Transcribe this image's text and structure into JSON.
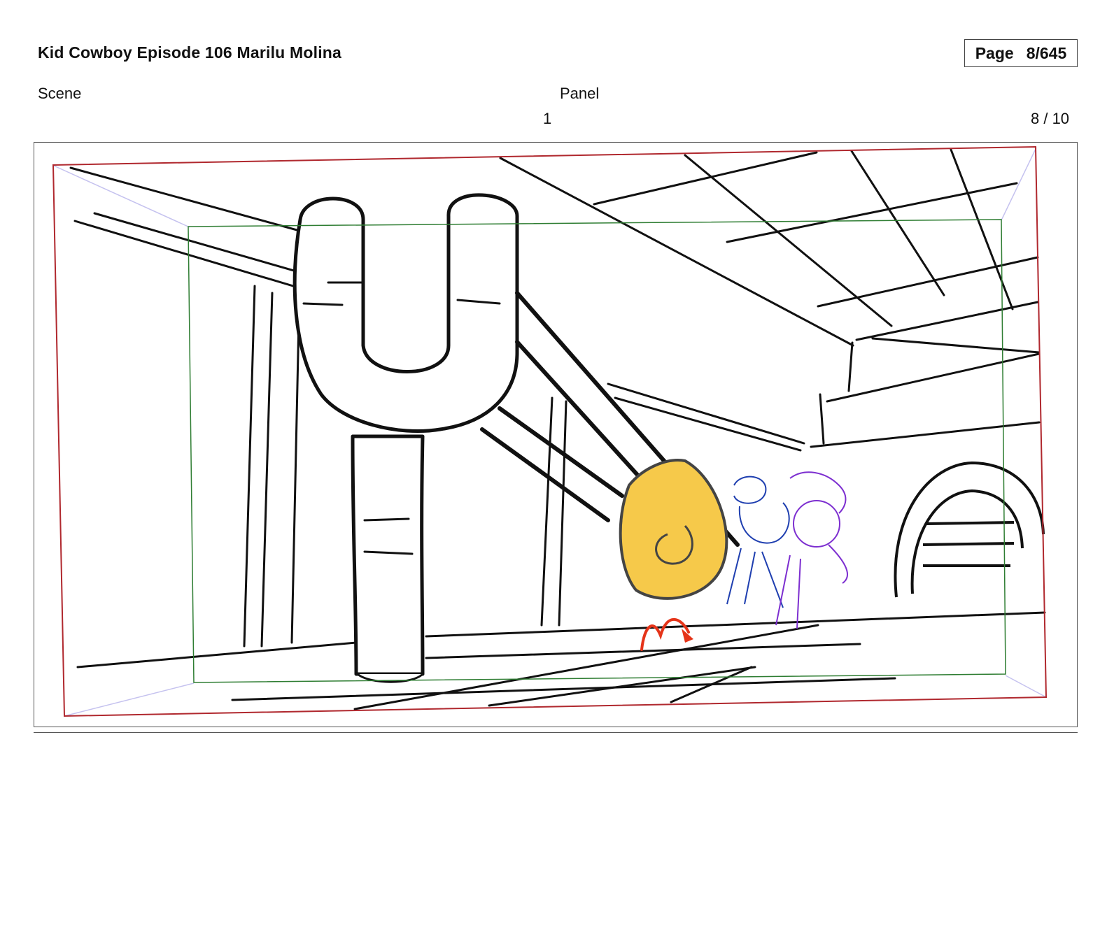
{
  "header": {
    "title": "Kid Cowboy Episode 106 Marilu Molina",
    "page_label": "Page",
    "page_value": "8/645"
  },
  "fields": {
    "scene_label": "Scene",
    "scene_value": "1",
    "panel_label": "Panel",
    "panel_value": "8 / 10"
  },
  "colors": {
    "camera_frame": "#b0282e",
    "safe_area": "#2e7d32",
    "perspective_guides": "#c5c2ef",
    "tumbleweed": "#f6c94a",
    "kid_cowboy": "#1f3fb0",
    "marilu": "#7d2fd0",
    "motion_arrow": "#e53419"
  },
  "drawing": {
    "icon": "storyboard-sketch"
  }
}
